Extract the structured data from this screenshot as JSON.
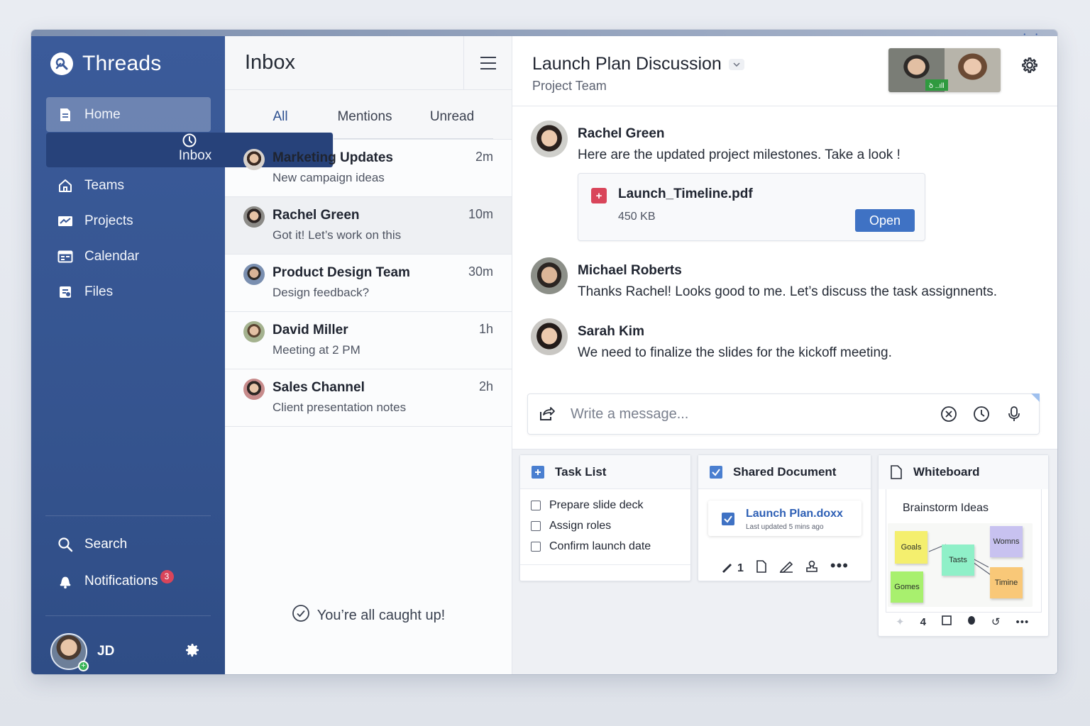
{
  "app": {
    "name": "Threads"
  },
  "sidebar": {
    "items": [
      {
        "label": "Home",
        "icon": "home-doc-icon"
      },
      {
        "label": "Inbox",
        "icon": "clock-icon"
      },
      {
        "label": "Teams",
        "icon": "house-icon"
      },
      {
        "label": "Projects",
        "icon": "mail-chart-icon"
      },
      {
        "label": "Calendar",
        "icon": "calendar-icon"
      },
      {
        "label": "Files",
        "icon": "file-icon"
      }
    ],
    "search_label": "Search",
    "notifications_label": "Notifications",
    "notifications_count": "3",
    "user_initials": "JD"
  },
  "inbox": {
    "title": "Inbox",
    "tabs": [
      "All",
      "Mentions",
      "Unread"
    ],
    "threads": [
      {
        "name": "Marketing Updates",
        "preview": "New campaign ideas",
        "time": "2m"
      },
      {
        "name": "Rachel Green",
        "preview": "Got it! Let’s work on this",
        "time": "10m"
      },
      {
        "name": "Product Design Team",
        "preview": "Design feedback?",
        "time": "30m"
      },
      {
        "name": "David Miller",
        "preview": "Meeting at 2 PM",
        "time": "1h"
      },
      {
        "name": "Sales Channel",
        "preview": "Client presentation notes",
        "time": "2h"
      }
    ],
    "caught_up": "You’re all caught up!"
  },
  "conversation": {
    "title": "Launch Plan Discussion",
    "subtitle": "Project Team",
    "video_badge": "ꝺ ..ıll",
    "messages": [
      {
        "author": "Rachel Green",
        "text": "Here are the updated project milestones. Take a look !"
      },
      {
        "author": "Michael Roberts",
        "text": "Thanks Rachel! Looks good to me. Let’s discuss the task assignnents."
      },
      {
        "author": "Sarah Kim",
        "text": "We need to finalize the slides for the kickoff meeting."
      }
    ],
    "attachment": {
      "filename": "Launch_Timeline.pdf",
      "size": "450 KB",
      "action": "Open"
    },
    "composer_placeholder": "Write a message..."
  },
  "widgets": {
    "task_list": {
      "title": "Task List",
      "tasks": [
        "Prepare slide deck",
        "Assign roles",
        "Confirm launch date"
      ]
    },
    "shared_document": {
      "title": "Shared Document",
      "doc_name": "Launch Plan.doxx",
      "updated": "Last updated 5 mins ago",
      "tool_number": "1"
    },
    "whiteboard": {
      "title": "Whiteboard",
      "board_title": "Brainstorm Ideas",
      "notes": [
        "Goals",
        "Tasts",
        "Womns",
        "Gomes",
        "Timine"
      ],
      "tool_number": "4"
    }
  },
  "colors": {
    "sidebar": "#3b5b9a",
    "accent": "#3f72c4",
    "badge": "#d9455a",
    "online": "#3bb55a"
  }
}
